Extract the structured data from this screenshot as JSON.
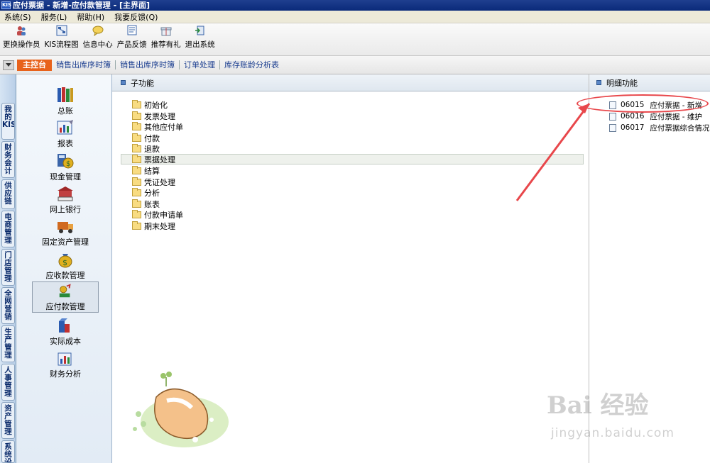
{
  "window": {
    "title": "应付票据 - 新增-应付款管理 - [主界面]",
    "icon_text": "KIS"
  },
  "menu": [
    "系统(S)",
    "服务(L)",
    "帮助(H)",
    "我要反馈(Q)"
  ],
  "toolbar": [
    {
      "label": "更换操作员",
      "icon": "user-switch-icon"
    },
    {
      "label": "KIS流程图",
      "icon": "flowchart-icon"
    },
    {
      "label": "信息中心",
      "icon": "chat-icon"
    },
    {
      "label": "产品反馈",
      "icon": "feedback-icon"
    },
    {
      "label": "推荐有礼",
      "icon": "gift-icon"
    },
    {
      "label": "退出系统",
      "icon": "exit-icon"
    }
  ],
  "tabs": {
    "active": "主控台",
    "items": [
      "销售出库序时簿",
      "销售出库序时簿",
      "订单处理",
      "库存账龄分析表"
    ]
  },
  "side_tabs": [
    "我的KIS",
    "财务会计",
    "供应链",
    "电商管理",
    "门店管理",
    "全网营销",
    "生产管理",
    "人事管理",
    "资产管理",
    "系统设置"
  ],
  "modules": [
    {
      "label": "总账",
      "icon": "books-icon"
    },
    {
      "label": "报表",
      "icon": "report-icon"
    },
    {
      "label": "现金管理",
      "icon": "cash-icon"
    },
    {
      "label": "网上银行",
      "icon": "bank-icon"
    },
    {
      "label": "固定资产管理",
      "icon": "truck-icon"
    },
    {
      "label": "应收款管理",
      "icon": "moneybag-icon"
    },
    {
      "label": "应付款管理",
      "icon": "payable-icon"
    },
    {
      "label": "实际成本",
      "icon": "cost-icon"
    },
    {
      "label": "财务分析",
      "icon": "analysis-icon"
    }
  ],
  "sub_panel": {
    "title": "子功能",
    "items": [
      "初始化",
      "发票处理",
      "其他应付单",
      "付款",
      "退款",
      "票据处理",
      "结算",
      "凭证处理",
      "分析",
      "账表",
      "付款申请单",
      "期末处理"
    ],
    "selected": "票据处理"
  },
  "detail_panel": {
    "title": "明细功能",
    "items": [
      {
        "code": "06015",
        "label": "应付票据 - 新增"
      },
      {
        "code": "06016",
        "label": "应付票据 - 维护"
      },
      {
        "code": "06017",
        "label": "应付票据综合情况表"
      }
    ]
  },
  "watermark": {
    "brand": "Bai 经验",
    "url": "jingyan.baidu.com"
  },
  "colors": {
    "accent": "#e8621b",
    "title_bar": "#0a2a7a",
    "annotation": "#e8474b"
  }
}
